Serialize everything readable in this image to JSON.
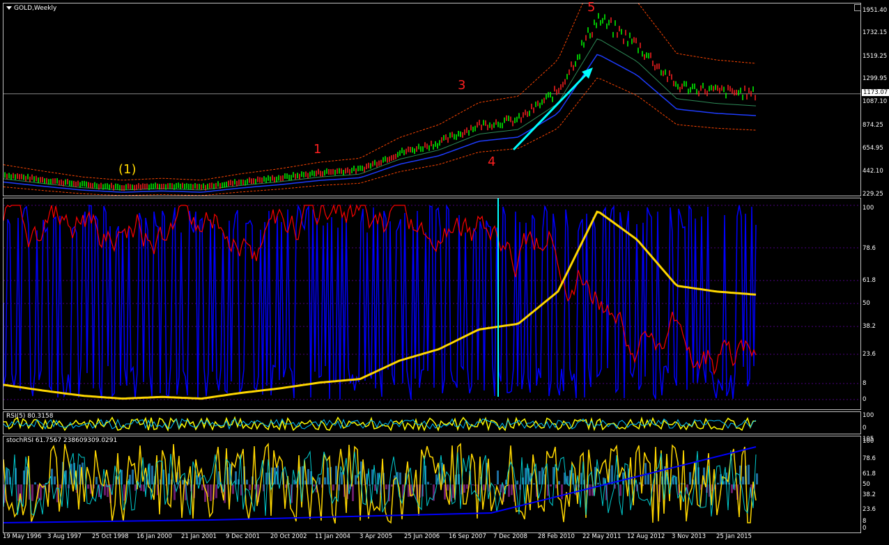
{
  "window": {
    "title": "GOLD,Weekly"
  },
  "price_axis": [
    "1951.40",
    "1732.15",
    "1519.25",
    "1299.95",
    "1087.10",
    "874.25",
    "654.95",
    "442.10",
    "229.25"
  ],
  "current_price": "1173.07",
  "osc_axis": [
    "100",
    "78.6",
    "61.8",
    "50",
    "38.2",
    "23.6",
    "8",
    "0"
  ],
  "rsi": {
    "label": "RSI(5) 80.3158",
    "axis": [
      "100",
      "0"
    ]
  },
  "stochrsi": {
    "label": "stochRSI 61.7567 238609309.0291",
    "axis": [
      "105",
      "100",
      "78.6",
      "61.8",
      "50",
      "38.2",
      "23.6",
      "8",
      "0",
      "-5.00"
    ]
  },
  "date_axis": [
    "19 May 1996",
    "3 Aug 1997",
    "25 Oct 1998",
    "16 Jan 2000",
    "21 Jan 2001",
    "9 Dec 2001",
    "20 Oct 2002",
    "11 Jan 2004",
    "3 Apr 2005",
    "25 Jun 2006",
    "16 Sep 2007",
    "7 Dec 2008",
    "28 Feb 2010",
    "22 May 2011",
    "12 Aug 2012",
    "3 Nov 2013",
    "25 Jan 2015"
  ],
  "annotations": [
    {
      "text": "(1)",
      "color": "#ffd700"
    },
    {
      "text": "1",
      "color": "#ff2020"
    },
    {
      "text": "3",
      "color": "#ff2020"
    },
    {
      "text": "4",
      "color": "#ff2020"
    },
    {
      "text": "5",
      "color": "#ff2020"
    }
  ],
  "colors": {
    "up": "#00ff00",
    "down": "#ff2020",
    "accent": "#00ffff",
    "yellow": "#ffd700",
    "blue": "#0000ff"
  },
  "chart_data": {
    "type": "line",
    "series": [
      {
        "values_x": [
          1996,
          1997,
          1998,
          1999,
          2000,
          2001,
          2002,
          2003,
          2004,
          2005,
          2006,
          2007,
          2008,
          2009,
          2010,
          2011,
          2012,
          2013,
          2014,
          2015
        ],
        "values": [
          390,
          340,
          295,
          270,
          285,
          270,
          320,
          360,
          410,
          440,
          600,
          700,
          870,
          920,
          1200,
          1900,
          1650,
          1250,
          1200,
          1173
        ]
      }
    ],
    "ylim": [
      229.25,
      1951.4
    ],
    "grid": false
  }
}
